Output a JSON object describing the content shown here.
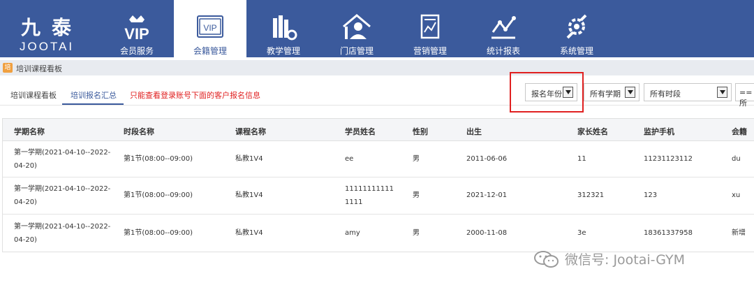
{
  "brand": {
    "cn": "九泰",
    "en": "JOOTAI"
  },
  "nav": [
    {
      "label": "会员服务",
      "icon": "vip-crown-icon"
    },
    {
      "label": "会籍管理",
      "icon": "vip-card-icon"
    },
    {
      "label": "教学管理",
      "icon": "books-gear-icon"
    },
    {
      "label": "门店管理",
      "icon": "store-person-icon"
    },
    {
      "label": "营销管理",
      "icon": "chart-document-icon"
    },
    {
      "label": "统计报表",
      "icon": "line-chart-icon"
    },
    {
      "label": "系统管理",
      "icon": "wrench-gear-icon"
    }
  ],
  "nav_active_index": 1,
  "breadcrumb": {
    "icon_glyph": "培",
    "label": "培训课程看板"
  },
  "tabs": [
    {
      "label": "培训课程看板"
    },
    {
      "label": "培训报名汇总"
    }
  ],
  "warning": "只能查看登录账号下面的客户报名信息",
  "filters": {
    "year": "报名年份",
    "term": "所有学期",
    "period": "所有时段",
    "extra": "==所"
  },
  "table": {
    "headers": [
      "学期名称",
      "时段名称",
      "课程名称",
      "学员姓名",
      "性别",
      "出生",
      "家长姓名",
      "监护手机",
      "会籍"
    ],
    "rows": [
      {
        "term": "第一学期(2021-04-10--2022-04-20)",
        "period": "第1节(08:00--09:00)",
        "course": "私教1V4",
        "student": "ee",
        "gender": "男",
        "birth": "2011-06-06",
        "parent": "11",
        "phone": "11231123112",
        "membership": "du"
      },
      {
        "term": "第一学期(2021-04-10--2022-04-20)",
        "period": "第1节(08:00--09:00)",
        "course": "私教1V4",
        "student": "111111111111111",
        "gender": "男",
        "birth": "2021-12-01",
        "parent": "312321",
        "phone": "123",
        "membership": "xu"
      },
      {
        "term": "第一学期(2021-04-10--2022-04-20)",
        "period": "第1节(08:00--09:00)",
        "course": "私教1V4",
        "student": "amy",
        "gender": "男",
        "birth": "2000-11-08",
        "parent": "3e",
        "phone": "18361337958",
        "membership": "新增"
      }
    ]
  },
  "watermark": "微信号: Jootai-GYM",
  "colors": {
    "nav_bg": "#3b5a9c",
    "warning": "#e02020",
    "highlight": "#e02020"
  }
}
